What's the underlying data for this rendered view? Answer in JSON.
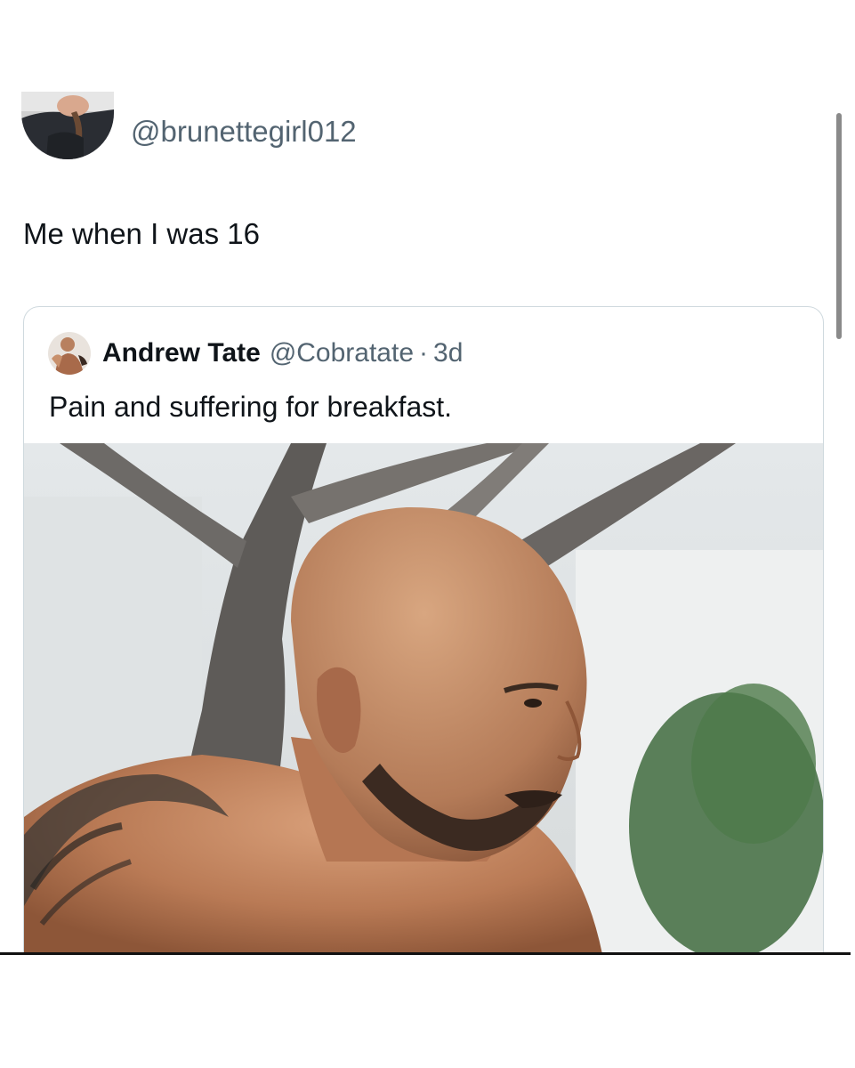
{
  "post": {
    "handle": "@brunettegirl012",
    "text": "Me when I was 16",
    "avatar_icon": "user-avatar"
  },
  "quote": {
    "author_name": "Andrew Tate",
    "author_handle": "@Cobratate",
    "separator": "·",
    "time": "3d",
    "text": "Pain and suffering for breakfast.",
    "avatar_icon": "user-avatar",
    "photo_description_icon": "photo"
  },
  "colors": {
    "text_primary": "#0f1419",
    "text_secondary": "#536471",
    "border": "#cfd9de"
  }
}
